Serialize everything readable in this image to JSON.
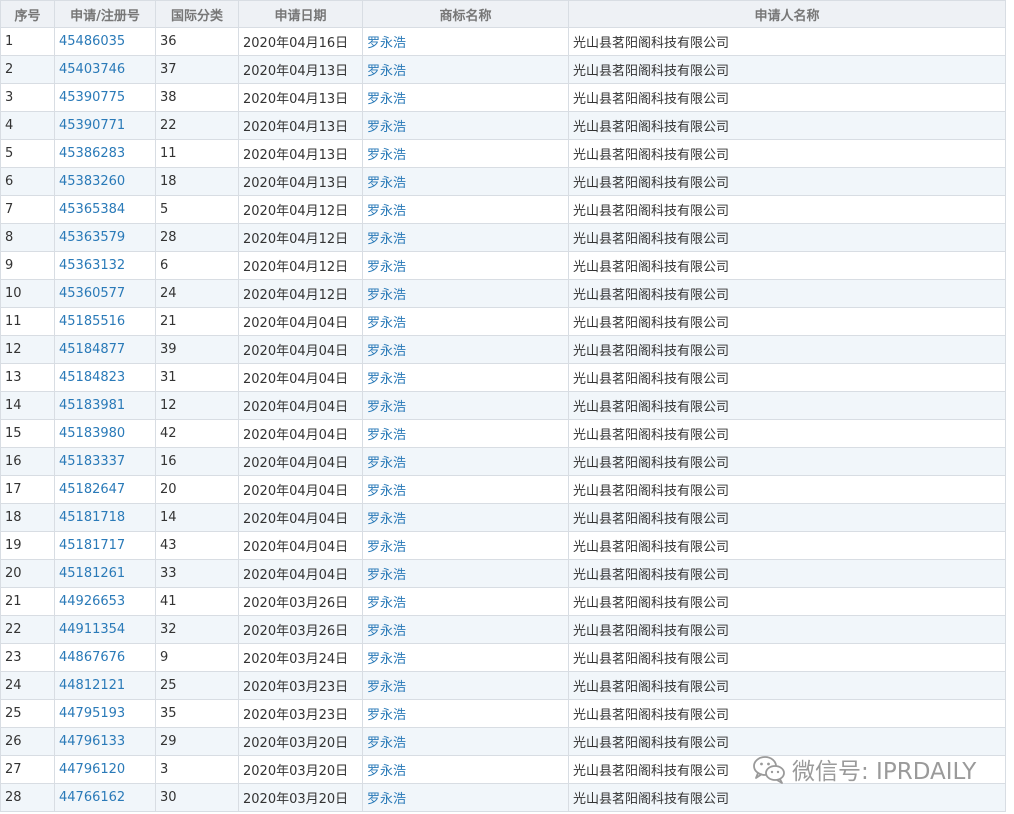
{
  "table": {
    "headers": [
      "序号",
      "申请/注册号",
      "国际分类",
      "申请日期",
      "商标名称",
      "申请人名称"
    ],
    "rows": [
      [
        "1",
        "45486035",
        "36",
        "2020年04月16日",
        "罗永浩",
        "光山县茗阳阁科技有限公司"
      ],
      [
        "2",
        "45403746",
        "37",
        "2020年04月13日",
        "罗永浩",
        "光山县茗阳阁科技有限公司"
      ],
      [
        "3",
        "45390775",
        "38",
        "2020年04月13日",
        "罗永浩",
        "光山县茗阳阁科技有限公司"
      ],
      [
        "4",
        "45390771",
        "22",
        "2020年04月13日",
        "罗永浩",
        "光山县茗阳阁科技有限公司"
      ],
      [
        "5",
        "45386283",
        "11",
        "2020年04月13日",
        "罗永浩",
        "光山县茗阳阁科技有限公司"
      ],
      [
        "6",
        "45383260",
        "18",
        "2020年04月13日",
        "罗永浩",
        "光山县茗阳阁科技有限公司"
      ],
      [
        "7",
        "45365384",
        "5",
        "2020年04月12日",
        "罗永浩",
        "光山县茗阳阁科技有限公司"
      ],
      [
        "8",
        "45363579",
        "28",
        "2020年04月12日",
        "罗永浩",
        "光山县茗阳阁科技有限公司"
      ],
      [
        "9",
        "45363132",
        "6",
        "2020年04月12日",
        "罗永浩",
        "光山县茗阳阁科技有限公司"
      ],
      [
        "10",
        "45360577",
        "24",
        "2020年04月12日",
        "罗永浩",
        "光山县茗阳阁科技有限公司"
      ],
      [
        "11",
        "45185516",
        "21",
        "2020年04月04日",
        "罗永浩",
        "光山县茗阳阁科技有限公司"
      ],
      [
        "12",
        "45184877",
        "39",
        "2020年04月04日",
        "罗永浩",
        "光山县茗阳阁科技有限公司"
      ],
      [
        "13",
        "45184823",
        "31",
        "2020年04月04日",
        "罗永浩",
        "光山县茗阳阁科技有限公司"
      ],
      [
        "14",
        "45183981",
        "12",
        "2020年04月04日",
        "罗永浩",
        "光山县茗阳阁科技有限公司"
      ],
      [
        "15",
        "45183980",
        "42",
        "2020年04月04日",
        "罗永浩",
        "光山县茗阳阁科技有限公司"
      ],
      [
        "16",
        "45183337",
        "16",
        "2020年04月04日",
        "罗永浩",
        "光山县茗阳阁科技有限公司"
      ],
      [
        "17",
        "45182647",
        "20",
        "2020年04月04日",
        "罗永浩",
        "光山县茗阳阁科技有限公司"
      ],
      [
        "18",
        "45181718",
        "14",
        "2020年04月04日",
        "罗永浩",
        "光山县茗阳阁科技有限公司"
      ],
      [
        "19",
        "45181717",
        "43",
        "2020年04月04日",
        "罗永浩",
        "光山县茗阳阁科技有限公司"
      ],
      [
        "20",
        "45181261",
        "33",
        "2020年04月04日",
        "罗永浩",
        "光山县茗阳阁科技有限公司"
      ],
      [
        "21",
        "44926653",
        "41",
        "2020年03月26日",
        "罗永浩",
        "光山县茗阳阁科技有限公司"
      ],
      [
        "22",
        "44911354",
        "32",
        "2020年03月26日",
        "罗永浩",
        "光山县茗阳阁科技有限公司"
      ],
      [
        "23",
        "44867676",
        "9",
        "2020年03月24日",
        "罗永浩",
        "光山县茗阳阁科技有限公司"
      ],
      [
        "24",
        "44812121",
        "25",
        "2020年03月23日",
        "罗永浩",
        "光山县茗阳阁科技有限公司"
      ],
      [
        "25",
        "44795193",
        "35",
        "2020年03月23日",
        "罗永浩",
        "光山县茗阳阁科技有限公司"
      ],
      [
        "26",
        "44796133",
        "29",
        "2020年03月20日",
        "罗永浩",
        "光山县茗阳阁科技有限公司"
      ],
      [
        "27",
        "44796120",
        "3",
        "2020年03月20日",
        "罗永浩",
        "光山县茗阳阁科技有限公司"
      ],
      [
        "28",
        "44766162",
        "30",
        "2020年03月20日",
        "罗永浩",
        "光山县茗阳阁科技有限公司"
      ]
    ]
  },
  "watermark": {
    "text": "微信号: IPRDAILY",
    "icon": "wechat-icon"
  }
}
